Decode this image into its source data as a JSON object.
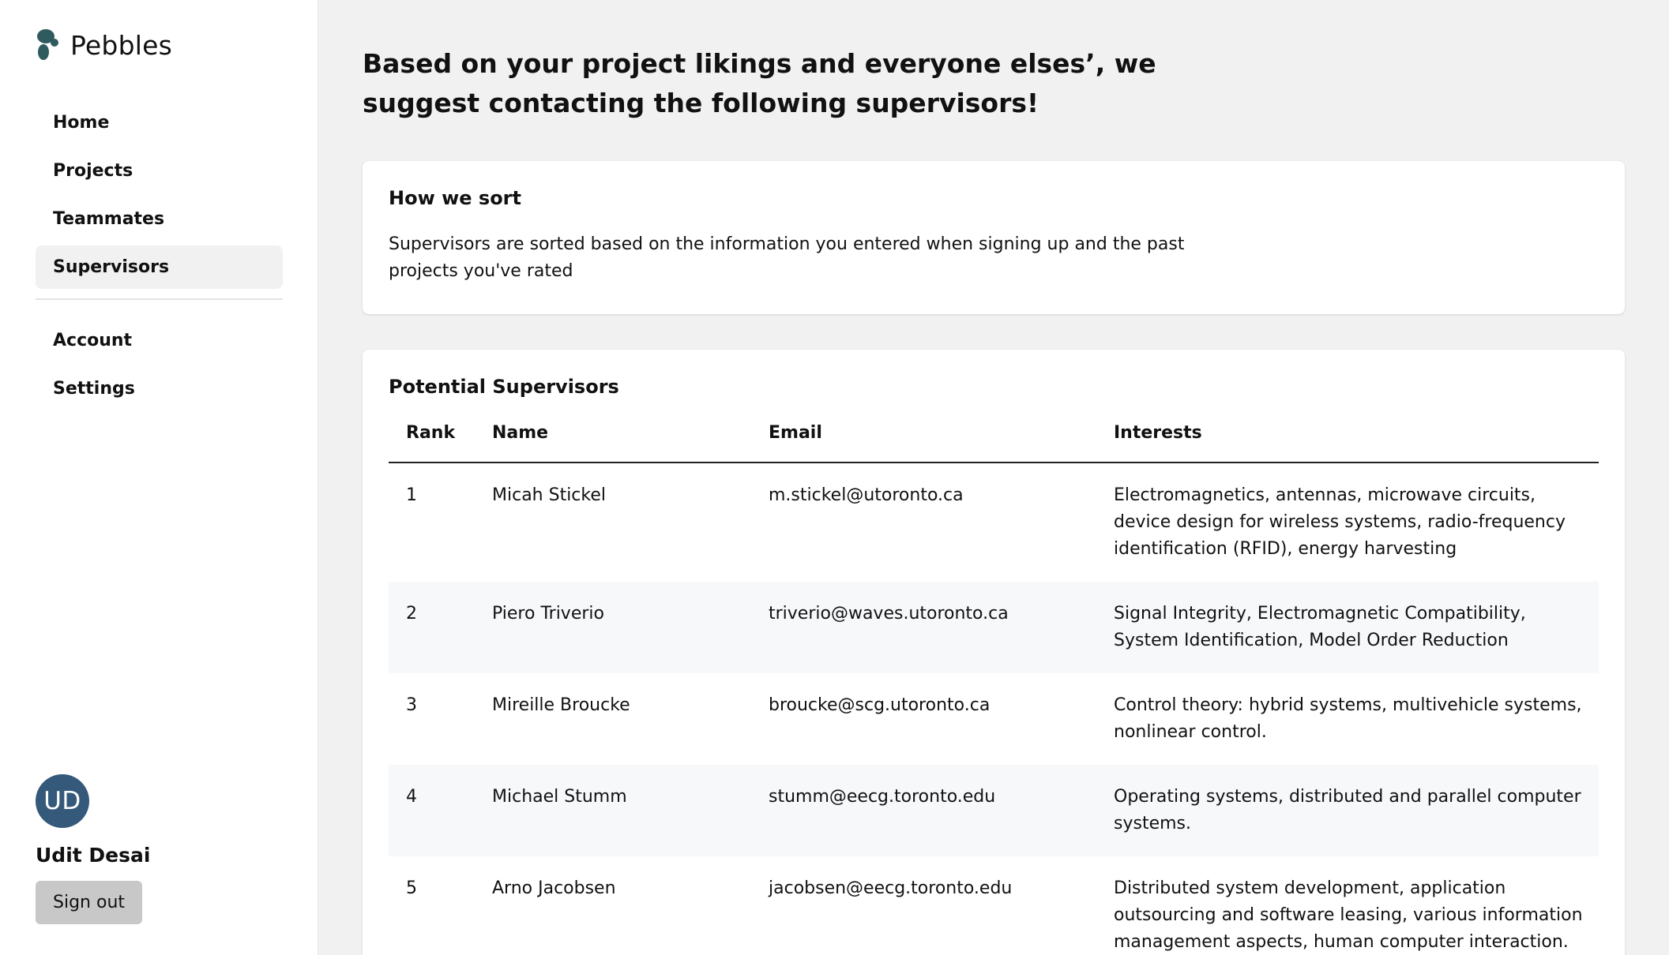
{
  "app": {
    "name": "Pebbles"
  },
  "sidebar": {
    "nav_primary": [
      {
        "label": "Home",
        "active": false
      },
      {
        "label": "Projects",
        "active": false
      },
      {
        "label": "Teammates",
        "active": false
      },
      {
        "label": "Supervisors",
        "active": true
      }
    ],
    "nav_secondary": [
      {
        "label": "Account"
      },
      {
        "label": "Settings"
      }
    ],
    "user": {
      "initials": "UD",
      "name": "Udit Desai",
      "signout_label": "Sign out"
    }
  },
  "main": {
    "title": "Based on your project likings and everyone elses’, we suggest contacting the following supervisors!",
    "how_we_sort": {
      "title": "How we sort",
      "text": "Supervisors are sorted based on the information you entered when signing up and the past projects you've rated"
    },
    "supervisors": {
      "title": "Potential Supervisors",
      "columns": [
        "Rank",
        "Name",
        "Email",
        "Interests"
      ],
      "rows": [
        {
          "rank": "1",
          "name": "Micah Stickel",
          "email": "m.stickel@utoronto.ca",
          "interests": "Electromagnetics, antennas, microwave circuits, device design for wireless systems, radio-frequency identification (RFID), energy harvesting"
        },
        {
          "rank": "2",
          "name": "Piero Triverio",
          "email": "triverio@waves.utoronto.ca",
          "interests": "Signal Integrity, Electromagnetic Compatibility, System Identification, Model Order Reduction"
        },
        {
          "rank": "3",
          "name": "Mireille Broucke",
          "email": "broucke@scg.utoronto.ca",
          "interests": "Control theory: hybrid systems, multivehicle systems, nonlinear control."
        },
        {
          "rank": "4",
          "name": "Michael Stumm",
          "email": "stumm@eecg.toronto.edu",
          "interests": "Operating systems, distributed and parallel computer systems."
        },
        {
          "rank": "5",
          "name": "Arno Jacobsen",
          "email": "jacobsen@eecg.toronto.edu",
          "interests": "Distributed system development, application outsourcing and software leasing, various information management aspects, human computer interaction."
        }
      ]
    }
  },
  "colors": {
    "background": "#f1f1f1",
    "sidebar": "#ffffff",
    "logo": "#2f5a5e",
    "avatar": "#34597a",
    "signout_button": "#c8c8c8",
    "stripe_row": "#f7f8fa"
  },
  "icons": {
    "logo": "pebbles-logo-icon"
  }
}
